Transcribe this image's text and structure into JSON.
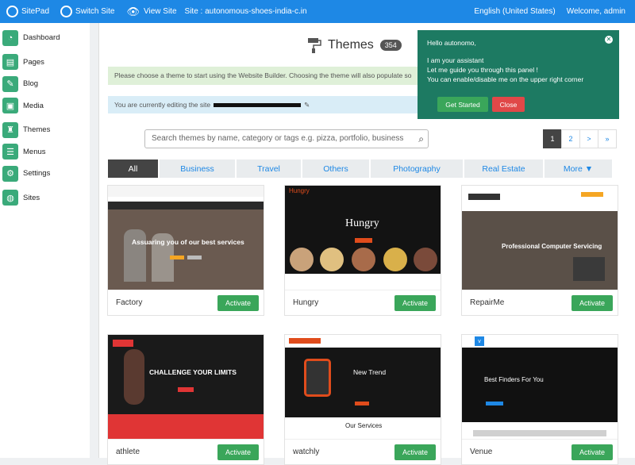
{
  "topbar": {
    "brand": "SitePad",
    "switch_site": "Switch Site",
    "view_site": "View Site",
    "site_label": "Site : autonomous-shoes-india-c.in",
    "language": "English (United States)",
    "welcome": "Welcome, admin"
  },
  "sidebar": {
    "items": [
      {
        "label": "Dashboard",
        "icon": "dashboard-icon"
      },
      {
        "label": "Pages",
        "icon": "pages-icon"
      },
      {
        "label": "Blog",
        "icon": "blog-icon"
      },
      {
        "label": "Media",
        "icon": "media-icon"
      },
      {
        "label": "Themes",
        "icon": "themes-icon"
      },
      {
        "label": "Menus",
        "icon": "menus-icon"
      },
      {
        "label": "Settings",
        "icon": "settings-icon"
      },
      {
        "label": "Sites",
        "icon": "sites-icon"
      }
    ]
  },
  "main": {
    "title": "Themes",
    "count": "354",
    "notice_choose": "Please choose a theme to start using the Website Builder. Choosing the theme will also populate so",
    "notice_editing": "You are currently editing the site",
    "search_placeholder": "Search themes by name, category or tags e.g. pizza, portfolio, business",
    "pager": [
      "1",
      "2",
      ">",
      "»"
    ],
    "tabs": [
      "All",
      "Business",
      "Travel",
      "Others",
      "Photography",
      "Real Estate",
      "More ▼"
    ],
    "activate_label": "Activate",
    "themes": [
      {
        "name": "Factory",
        "hero": "Assuaring you of our best services"
      },
      {
        "name": "Hungry",
        "hero": "Hungry"
      },
      {
        "name": "RepairMe",
        "hero": "Professional Computer Servicing"
      },
      {
        "name": "athlete",
        "hero": "CHALLENGE YOUR LIMITS"
      },
      {
        "name": "watchly",
        "hero": "New Trend",
        "sub": "Our Services"
      },
      {
        "name": "Venue",
        "hero": "Best Finders For You"
      }
    ]
  },
  "assistant": {
    "greeting": "Hello autonomo,",
    "line1": "I am your assistant",
    "line2": "Let me guide you through this panel !",
    "line3": "You can enable/disable me on the upper right corner",
    "get_started": "Get Started",
    "close": "Close"
  },
  "colors": {
    "accent": "#1e88e5",
    "sidebar_icon": "#3aaa7a",
    "activate": "#3aa65a",
    "popup": "#1d7a62",
    "close_btn": "#e04848"
  }
}
